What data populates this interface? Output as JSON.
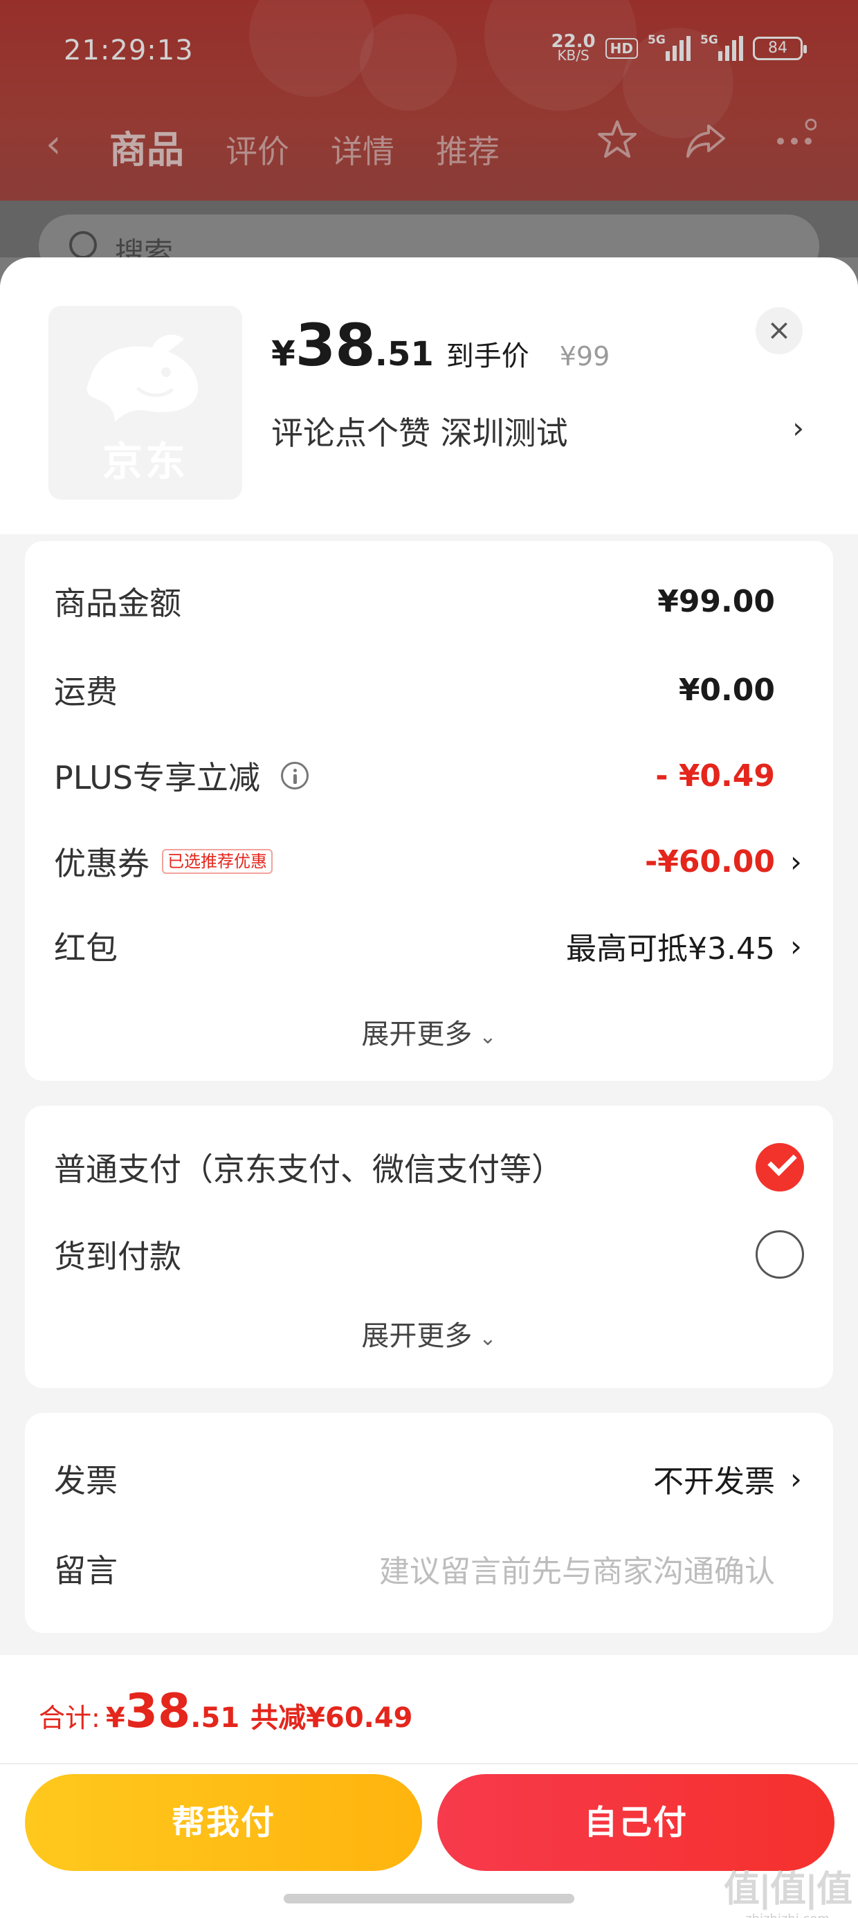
{
  "status_bar": {
    "time": "21:29:13",
    "net_speed_value": "22.0",
    "net_speed_unit": "KB/S",
    "hd_label": "HD",
    "signal1_label": "5G",
    "signal2_label": "5G",
    "battery": "84"
  },
  "nav": {
    "back_icon": "back-arrow-icon",
    "tabs": [
      "商品",
      "评价",
      "详情",
      "推荐"
    ],
    "active_tab": "商品",
    "icons": [
      "star-icon",
      "share-icon",
      "more-icon"
    ]
  },
  "search": {
    "placeholder": "搜索"
  },
  "product": {
    "logo_text": "京东",
    "price_symbol": "¥",
    "price_int": "38",
    "price_dec": ".51",
    "price_tag": "到手价",
    "original_price": "¥99",
    "spec": "评论点个赞  深圳测试",
    "spec_arrow": "›",
    "close_label": "×"
  },
  "fees": {
    "rows": [
      {
        "label": "商品金额",
        "value": "¥99.00"
      },
      {
        "label": "运费",
        "value": "¥0.00"
      },
      {
        "label": "PLUS专享立减",
        "value": "- ¥0.49"
      },
      {
        "label": "优惠券",
        "badge": "已选推荐优惠",
        "value": "-¥60.00",
        "arrow": "›"
      },
      {
        "label": "红包",
        "value": "最高可抵¥3.45",
        "arrow": "›"
      }
    ],
    "expand_label": "展开更多",
    "expand_caret": "⌄"
  },
  "payment": {
    "options": [
      {
        "label": "普通支付（京东支付、微信支付等）",
        "selected": true
      },
      {
        "label": "货到付款",
        "selected": false
      }
    ],
    "expand_label": "展开更多",
    "expand_caret": "⌄"
  },
  "extras": {
    "invoice_label": "发票",
    "invoice_value": "不开发票",
    "invoice_arrow": "›",
    "message_label": "留言",
    "message_placeholder": "建议留言前先与商家沟通确认"
  },
  "footer": {
    "total_label": "合计:",
    "total_symbol": "¥",
    "total_int": "38",
    "total_dec": ".51",
    "total_saved": "共减¥60.49",
    "help_pay_label": "帮我付",
    "self_pay_label": "自己付",
    "watermark_big": "值|值|值",
    "watermark_small": "zhizhizhi.com"
  },
  "colors": {
    "accent_red": "#e4261c",
    "pay_yellow": "#ffb40e",
    "pay_red": "#f5312d",
    "header_red": "#b73a34"
  }
}
